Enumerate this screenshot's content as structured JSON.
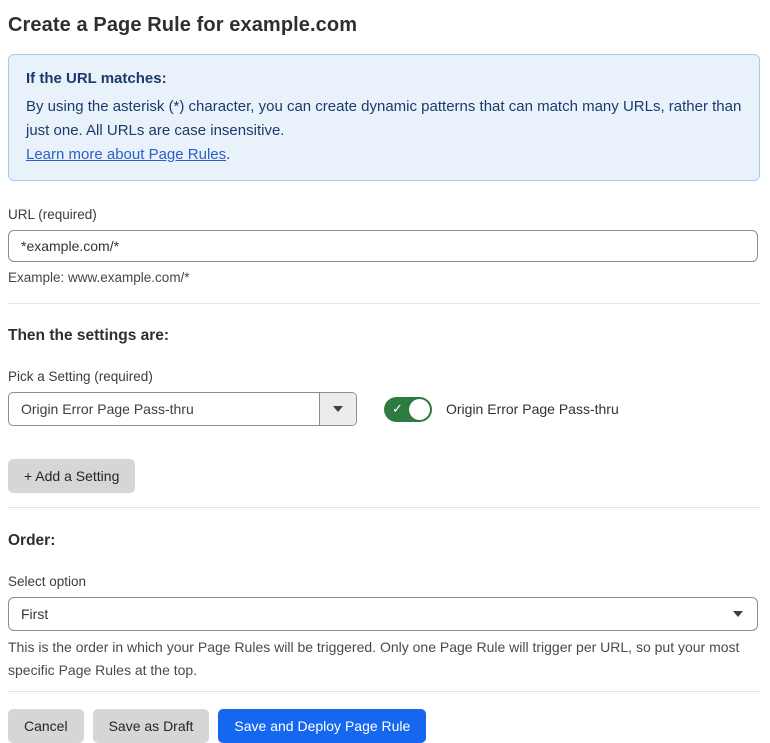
{
  "page": {
    "title": "Create a Page Rule for example.com"
  },
  "info_box": {
    "heading": "If the URL matches:",
    "body": "By using the asterisk (*) character, you can create dynamic patterns that can match many URLs, rather than just one. All URLs are case insensitive.",
    "link_label": "Learn more about Page Rules",
    "link_suffix": "."
  },
  "url_field": {
    "label": "URL (required)",
    "value": "*example.com/*",
    "helper": "Example: www.example.com/*"
  },
  "settings_section": {
    "heading": "Then the settings are:",
    "picker_label": "Pick a Setting (required)",
    "picker_value": "Origin Error Page Pass-thru",
    "toggle": {
      "state": "on",
      "check_glyph": "✓",
      "label": "Origin Error Page Pass-thru"
    },
    "add_setting_label": "+ Add a Setting"
  },
  "order_section": {
    "heading": "Order:",
    "select_label": "Select option",
    "select_value": "First",
    "helper": "This is the order in which your Page Rules will be triggered. Only one Page Rule will trigger per URL, so put your most specific Page Rules at the top."
  },
  "footer": {
    "cancel_label": "Cancel",
    "save_draft_label": "Save as Draft",
    "save_deploy_label": "Save and Deploy Page Rule"
  },
  "colors": {
    "info_box_bg": "#e9f2fb",
    "info_box_border": "#a9c9e9",
    "info_text": "#1b3a6b",
    "link_blue": "#2c5fc7",
    "toggle_on_green": "#2e7b41",
    "primary_button_blue": "#1667f0",
    "secondary_button_gray": "#d6d6d6",
    "input_border_gray": "#8d8d8d"
  }
}
